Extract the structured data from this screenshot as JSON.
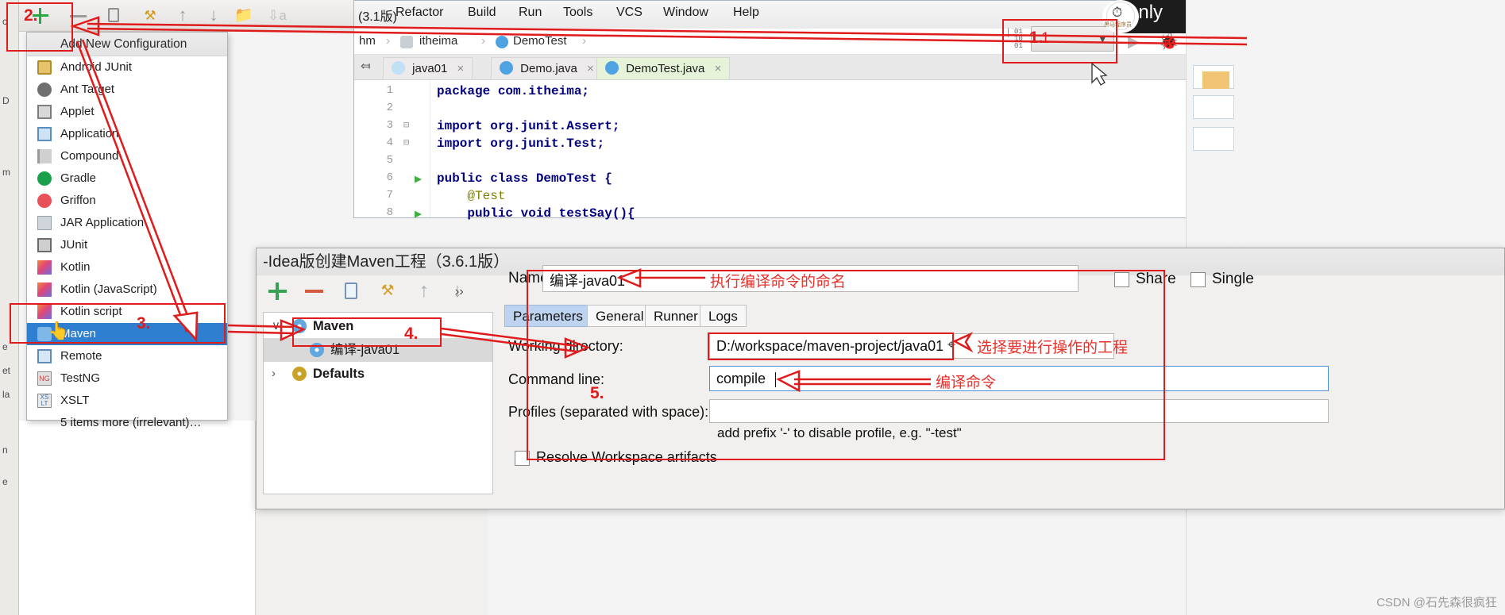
{
  "window": {
    "title_fragment": "(3.1版)",
    "menubar": [
      "Refactor",
      "Build",
      "Run",
      "Tools",
      "VCS",
      "Window",
      "Help"
    ],
    "right_label": "only"
  },
  "breadcrumbs": {
    "items": [
      "hm",
      "itheima",
      "DemoTest"
    ]
  },
  "editor": {
    "tabs": [
      {
        "label": "java01",
        "icon": "module-icon",
        "active": false,
        "close": "×"
      },
      {
        "label": "Demo.java",
        "icon": "class-icon",
        "active": false,
        "close": "×"
      },
      {
        "label": "DemoTest.java",
        "icon": "test-class-icon",
        "active": true,
        "close": "×"
      }
    ],
    "line_numbers": [
      "1",
      "2",
      "3",
      "4",
      "5",
      "6",
      "7",
      "8"
    ],
    "code": [
      "package com.itheima;",
      "",
      "import org.junit.Assert;",
      "import org.junit.Test;",
      "",
      "public class DemoTest {",
      "    @Test",
      "    public void testSay(){"
    ]
  },
  "run_widget": {
    "combo_value": "1.",
    "chevron": "⌄",
    "run_icon": "▶",
    "debug_icon": "🐞",
    "coverage_icon": "▓",
    "binary_rows": [
      "01",
      "10",
      "01"
    ],
    "down_arrow": "↓"
  },
  "toolbar_top": {
    "icons": [
      "plus-icon",
      "minus-icon",
      "copy-icon",
      "wrench-icon",
      "move-up-icon",
      "move-down-icon",
      "folder-icon",
      "sort-alphabetical-icon"
    ],
    "plus_marker": "2."
  },
  "add_config_popup": {
    "header": "Add New Configuration",
    "items": [
      {
        "label": "Android JUnit",
        "icon": "android-junit-icon"
      },
      {
        "label": "Ant Target",
        "icon": "ant-icon"
      },
      {
        "label": "Applet",
        "icon": "applet-icon"
      },
      {
        "label": "Application",
        "icon": "application-icon"
      },
      {
        "label": "Compound",
        "icon": "compound-icon"
      },
      {
        "label": "Gradle",
        "icon": "gradle-icon"
      },
      {
        "label": "Griffon",
        "icon": "griffon-icon"
      },
      {
        "label": "JAR Application",
        "icon": "jar-icon"
      },
      {
        "label": "JUnit",
        "icon": "junit-icon"
      },
      {
        "label": "Kotlin",
        "icon": "kotlin-icon"
      },
      {
        "label": "Kotlin (JavaScript)",
        "icon": "kotlin-icon"
      },
      {
        "label": "Kotlin script",
        "icon": "kotlin-icon"
      },
      {
        "label": "Maven",
        "icon": "maven-icon",
        "selected": true
      },
      {
        "label": "Remote",
        "icon": "remote-icon"
      },
      {
        "label": "TestNG",
        "icon": "testng-icon"
      },
      {
        "label": "XSLT",
        "icon": "xslt-icon"
      },
      {
        "label": "5 items more (irrelevant)…",
        "icon": "none"
      }
    ],
    "marker": "3."
  },
  "dialog": {
    "title": "-Idea版创建Maven工程（3.6.1版）",
    "toolbar_icons": [
      "add-icon",
      "remove-icon",
      "copy-configuration-icon",
      "edit-templates-icon",
      "move-up-icon",
      "move-down-icon"
    ],
    "toolbar_overflow": "››",
    "tree": [
      {
        "label": "Maven",
        "level": 0,
        "twisty": "∨",
        "icon": "maven-gear-icon",
        "bold": true
      },
      {
        "label": "编译-java01",
        "level": 1,
        "twisty": "",
        "icon": "maven-gear-icon",
        "bold": false,
        "selected": true,
        "marker": "4."
      },
      {
        "label": "Defaults",
        "level": 0,
        "twisty": "›",
        "icon": "defaults-wrench-icon",
        "bold": true
      }
    ],
    "name_label": "Name:",
    "name_value": "编译-java01",
    "tabs": [
      {
        "label": "Parameters",
        "active": true
      },
      {
        "label": "General",
        "active": false
      },
      {
        "label": "Runner",
        "active": false
      },
      {
        "label": "Logs",
        "active": false
      }
    ],
    "fields": [
      {
        "label": "Working directory:",
        "value": "D:/workspace/maven-project/java01",
        "focused": false
      },
      {
        "label": "Command line:",
        "value": "compile",
        "focused": true
      },
      {
        "label": "Profiles (separated with space):",
        "value": "",
        "focused": false
      }
    ],
    "hint": "add prefix '-' to disable profile, e.g. \"-test\"",
    "resolve_checkbox_label": "Resolve Workspace artifacts",
    "share_checkbox_label": "Share",
    "single_checkbox_label": "Single"
  },
  "annotations": {
    "step1": "1.",
    "step2": "2.",
    "step3": "3.",
    "step4": "4.",
    "step5": "5.",
    "name_note": "执行编译命令的命名",
    "working_dir_note": "选择要进行操作的工程",
    "command_note": "编译命令"
  },
  "watermark": "CSDN @石先森很疯狂",
  "colors": {
    "annotation_red": "#e01b1b",
    "selection_blue": "#2f7fd1",
    "tab_active_blue": "#bdd3ef",
    "focus_border": "#4a90d9"
  }
}
